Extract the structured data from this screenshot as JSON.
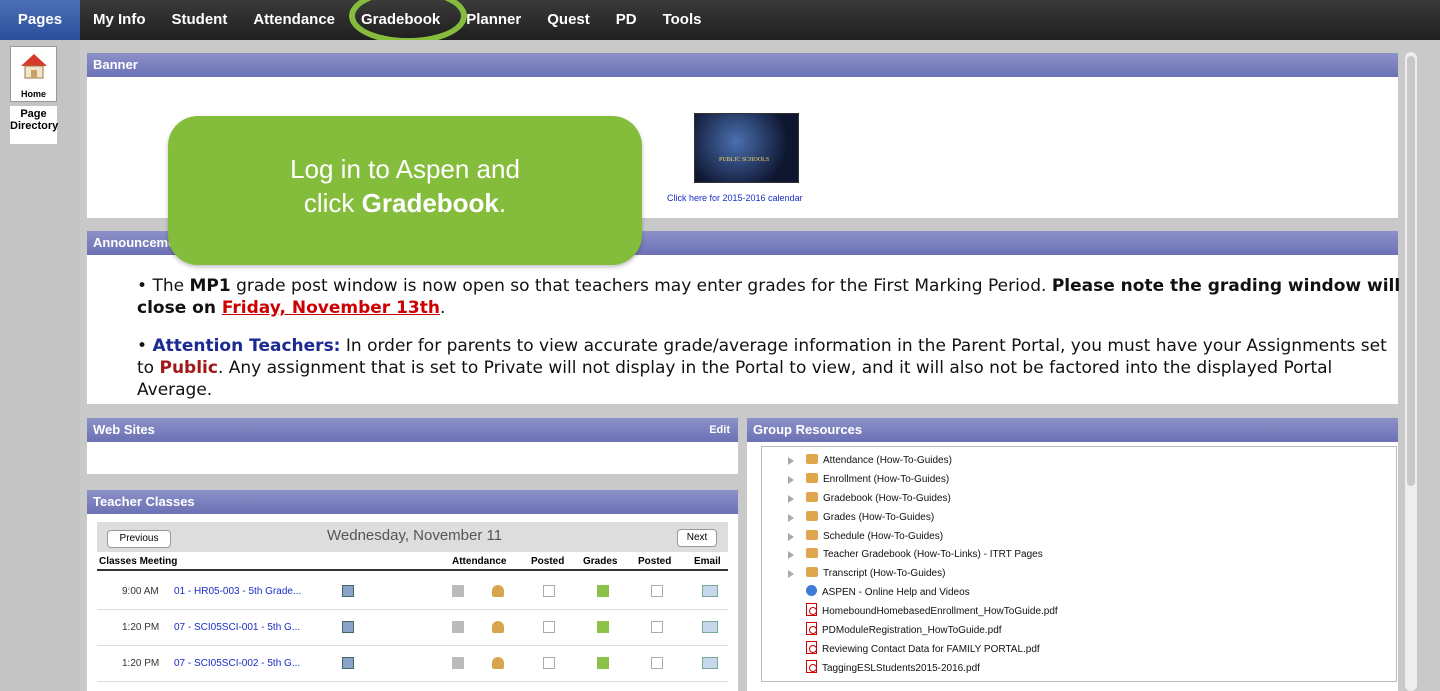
{
  "nav": {
    "tabs": [
      "Pages",
      "My Info",
      "Student",
      "Attendance",
      "Gradebook",
      "Planner",
      "Quest",
      "PD",
      "Tools"
    ]
  },
  "sidebar": {
    "home_label": "Home",
    "page_directory_line1": "Page",
    "page_directory_line2": "Directory"
  },
  "banner": {
    "header": "Banner",
    "image_text": "PUBLIC SCHOOLS",
    "link": "Click here for 2015-2016 calendar"
  },
  "callout": {
    "line1": "Log in to Aspen and",
    "line2_prefix": "click ",
    "line2_bold": "Gradebook",
    "line2_suffix": "."
  },
  "announcements": {
    "header": "Announcements",
    "item1": {
      "t1": "The ",
      "b1": "MP1",
      "t2": " grade post window is now open so that teachers may enter grades for the First Marking Period. ",
      "b2": "Please note the grading window will close on ",
      "link": "Friday, November 13th",
      "t3": "."
    },
    "item2": {
      "b1": "Attention Teachers:",
      "t1": " In order for parents to view accurate grade/average information in the Parent Portal, you must have your Assignments set to ",
      "b2": "Public",
      "t2": ". Any assignment that is set to Private will not display in the Portal to view, and it will also not be factored into the displayed Portal Average."
    }
  },
  "websites": {
    "header": "Web Sites",
    "edit": "Edit"
  },
  "teacher_classes": {
    "header": "Teacher Classes",
    "previous": "Previous",
    "next": "Next",
    "date": "Wednesday, November 11",
    "columns": [
      "Classes Meeting",
      "Attendance",
      "Posted",
      "Grades",
      "Posted",
      "Email"
    ],
    "rows": [
      {
        "time": "9:00 AM",
        "class": "01 - HR05-003 - 5th Grade..."
      },
      {
        "time": "1:20 PM",
        "class": "07 - SCI05SCI-001 - 5th G..."
      },
      {
        "time": "1:20 PM",
        "class": "07 - SCI05SCI-002 - 5th G..."
      }
    ]
  },
  "group_resources": {
    "header": "Group Resources",
    "items": [
      {
        "label": "Attendance (How-To-Guides)",
        "type": "folder"
      },
      {
        "label": "Enrollment (How-To-Guides)",
        "type": "folder"
      },
      {
        "label": "Gradebook (How-To-Guides)",
        "type": "folder"
      },
      {
        "label": "Grades (How-To-Guides)",
        "type": "folder"
      },
      {
        "label": "Schedule (How-To-Guides)",
        "type": "folder"
      },
      {
        "label": "Teacher Gradebook (How-To-Links) - ITRT Pages",
        "type": "folder"
      },
      {
        "label": "Transcript (How-To-Guides)",
        "type": "folder"
      },
      {
        "label": "ASPEN - Online Help and Videos",
        "type": "globe"
      },
      {
        "label": "HomeboundHomebasedEnrollment_HowToGuide.pdf",
        "type": "pdf"
      },
      {
        "label": "PDModuleRegistration_HowToGuide.pdf",
        "type": "pdf"
      },
      {
        "label": "Reviewing Contact Data for FAMILY PORTAL.pdf",
        "type": "pdf"
      },
      {
        "label": "TaggingESLStudents2015-2016.pdf",
        "type": "pdf"
      }
    ]
  },
  "colors": {
    "panel_header": "#7a7fbe",
    "callout": "#84bc3b",
    "nav_active": "#2c4f9a"
  }
}
